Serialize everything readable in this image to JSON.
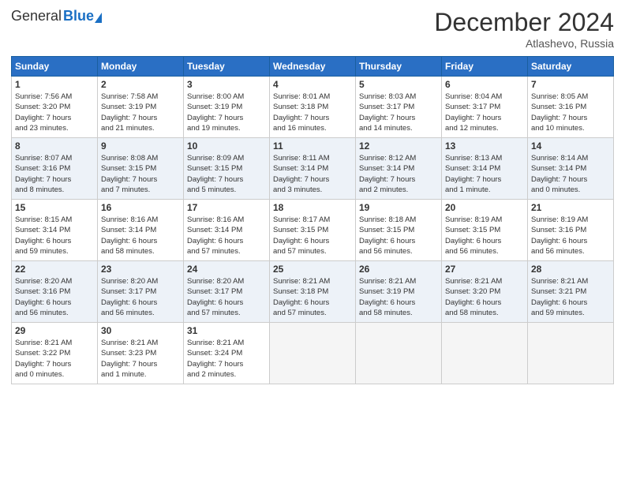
{
  "header": {
    "logo_general": "General",
    "logo_blue": "Blue",
    "month_title": "December 2024",
    "location": "Atlashevo, Russia"
  },
  "days_of_week": [
    "Sunday",
    "Monday",
    "Tuesday",
    "Wednesday",
    "Thursday",
    "Friday",
    "Saturday"
  ],
  "weeks": [
    [
      {
        "day": "1",
        "info": "Sunrise: 7:56 AM\nSunset: 3:20 PM\nDaylight: 7 hours\nand 23 minutes."
      },
      {
        "day": "2",
        "info": "Sunrise: 7:58 AM\nSunset: 3:19 PM\nDaylight: 7 hours\nand 21 minutes."
      },
      {
        "day": "3",
        "info": "Sunrise: 8:00 AM\nSunset: 3:19 PM\nDaylight: 7 hours\nand 19 minutes."
      },
      {
        "day": "4",
        "info": "Sunrise: 8:01 AM\nSunset: 3:18 PM\nDaylight: 7 hours\nand 16 minutes."
      },
      {
        "day": "5",
        "info": "Sunrise: 8:03 AM\nSunset: 3:17 PM\nDaylight: 7 hours\nand 14 minutes."
      },
      {
        "day": "6",
        "info": "Sunrise: 8:04 AM\nSunset: 3:17 PM\nDaylight: 7 hours\nand 12 minutes."
      },
      {
        "day": "7",
        "info": "Sunrise: 8:05 AM\nSunset: 3:16 PM\nDaylight: 7 hours\nand 10 minutes."
      }
    ],
    [
      {
        "day": "8",
        "info": "Sunrise: 8:07 AM\nSunset: 3:16 PM\nDaylight: 7 hours\nand 8 minutes."
      },
      {
        "day": "9",
        "info": "Sunrise: 8:08 AM\nSunset: 3:15 PM\nDaylight: 7 hours\nand 7 minutes."
      },
      {
        "day": "10",
        "info": "Sunrise: 8:09 AM\nSunset: 3:15 PM\nDaylight: 7 hours\nand 5 minutes."
      },
      {
        "day": "11",
        "info": "Sunrise: 8:11 AM\nSunset: 3:14 PM\nDaylight: 7 hours\nand 3 minutes."
      },
      {
        "day": "12",
        "info": "Sunrise: 8:12 AM\nSunset: 3:14 PM\nDaylight: 7 hours\nand 2 minutes."
      },
      {
        "day": "13",
        "info": "Sunrise: 8:13 AM\nSunset: 3:14 PM\nDaylight: 7 hours\nand 1 minute."
      },
      {
        "day": "14",
        "info": "Sunrise: 8:14 AM\nSunset: 3:14 PM\nDaylight: 7 hours\nand 0 minutes."
      }
    ],
    [
      {
        "day": "15",
        "info": "Sunrise: 8:15 AM\nSunset: 3:14 PM\nDaylight: 6 hours\nand 59 minutes."
      },
      {
        "day": "16",
        "info": "Sunrise: 8:16 AM\nSunset: 3:14 PM\nDaylight: 6 hours\nand 58 minutes."
      },
      {
        "day": "17",
        "info": "Sunrise: 8:16 AM\nSunset: 3:14 PM\nDaylight: 6 hours\nand 57 minutes."
      },
      {
        "day": "18",
        "info": "Sunrise: 8:17 AM\nSunset: 3:15 PM\nDaylight: 6 hours\nand 57 minutes."
      },
      {
        "day": "19",
        "info": "Sunrise: 8:18 AM\nSunset: 3:15 PM\nDaylight: 6 hours\nand 56 minutes."
      },
      {
        "day": "20",
        "info": "Sunrise: 8:19 AM\nSunset: 3:15 PM\nDaylight: 6 hours\nand 56 minutes."
      },
      {
        "day": "21",
        "info": "Sunrise: 8:19 AM\nSunset: 3:16 PM\nDaylight: 6 hours\nand 56 minutes."
      }
    ],
    [
      {
        "day": "22",
        "info": "Sunrise: 8:20 AM\nSunset: 3:16 PM\nDaylight: 6 hours\nand 56 minutes."
      },
      {
        "day": "23",
        "info": "Sunrise: 8:20 AM\nSunset: 3:17 PM\nDaylight: 6 hours\nand 56 minutes."
      },
      {
        "day": "24",
        "info": "Sunrise: 8:20 AM\nSunset: 3:17 PM\nDaylight: 6 hours\nand 57 minutes."
      },
      {
        "day": "25",
        "info": "Sunrise: 8:21 AM\nSunset: 3:18 PM\nDaylight: 6 hours\nand 57 minutes."
      },
      {
        "day": "26",
        "info": "Sunrise: 8:21 AM\nSunset: 3:19 PM\nDaylight: 6 hours\nand 58 minutes."
      },
      {
        "day": "27",
        "info": "Sunrise: 8:21 AM\nSunset: 3:20 PM\nDaylight: 6 hours\nand 58 minutes."
      },
      {
        "day": "28",
        "info": "Sunrise: 8:21 AM\nSunset: 3:21 PM\nDaylight: 6 hours\nand 59 minutes."
      }
    ],
    [
      {
        "day": "29",
        "info": "Sunrise: 8:21 AM\nSunset: 3:22 PM\nDaylight: 7 hours\nand 0 minutes."
      },
      {
        "day": "30",
        "info": "Sunrise: 8:21 AM\nSunset: 3:23 PM\nDaylight: 7 hours\nand 1 minute."
      },
      {
        "day": "31",
        "info": "Sunrise: 8:21 AM\nSunset: 3:24 PM\nDaylight: 7 hours\nand 2 minutes."
      },
      {
        "day": "",
        "info": ""
      },
      {
        "day": "",
        "info": ""
      },
      {
        "day": "",
        "info": ""
      },
      {
        "day": "",
        "info": ""
      }
    ]
  ]
}
